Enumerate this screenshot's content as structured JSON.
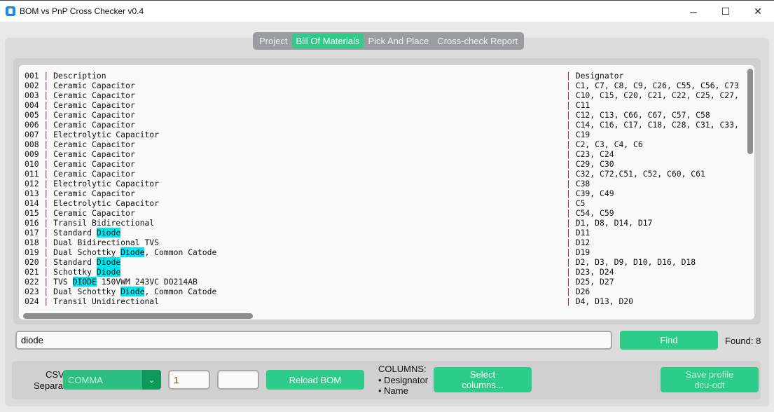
{
  "window": {
    "title": "BOM vs PnP Cross Checker v0.4",
    "minimize": "─",
    "maximize": "☐",
    "close": "✕"
  },
  "tabs": [
    {
      "label": "Project",
      "active": false
    },
    {
      "label": "Bill Of Materials",
      "active": true
    },
    {
      "label": "Pick And Place",
      "active": false
    },
    {
      "label": "Cross-check Report",
      "active": false
    }
  ],
  "highlight": "diode",
  "rows": [
    {
      "n": "001",
      "desc": "Description",
      "des": "Designator"
    },
    {
      "n": "002",
      "desc": "Ceramic Capacitor",
      "des": "C1, C7, C8, C9, C26, C55, C56, C73"
    },
    {
      "n": "003",
      "desc": "Ceramic Capacitor",
      "des": "C10, C15, C20, C21, C22, C25, C27,"
    },
    {
      "n": "004",
      "desc": "Ceramic Capacitor",
      "des": "C11"
    },
    {
      "n": "005",
      "desc": "Ceramic Capacitor",
      "des": "C12, C13, C66, C67, C57, C58"
    },
    {
      "n": "006",
      "desc": "Ceramic Capacitor",
      "des": "C14, C16, C17, C18, C28, C31, C33,"
    },
    {
      "n": "007",
      "desc": "Electrolytic Capacitor",
      "des": "C19"
    },
    {
      "n": "008",
      "desc": "Ceramic Capacitor",
      "des": "C2, C3, C4, C6"
    },
    {
      "n": "009",
      "desc": "Ceramic Capacitor",
      "des": "C23, C24"
    },
    {
      "n": "010",
      "desc": "Ceramic Capacitor",
      "des": "C29, C30"
    },
    {
      "n": "011",
      "desc": "Ceramic Capacitor",
      "des": "C32, C72,C51, C52, C60, C61"
    },
    {
      "n": "012",
      "desc": "Electrolytic Capacitor",
      "des": "C38"
    },
    {
      "n": "013",
      "desc": "Ceramic Capacitor",
      "des": "C39, C49"
    },
    {
      "n": "014",
      "desc": "Electrolytic Capacitor",
      "des": "C5"
    },
    {
      "n": "015",
      "desc": "Ceramic Capacitor",
      "des": "C54, C59"
    },
    {
      "n": "016",
      "desc": "Transil Bidirectional",
      "des": "D1, D8, D14, D17"
    },
    {
      "n": "017",
      "desc": "Standard Diode",
      "des": "D11"
    },
    {
      "n": "018",
      "desc": "Dual Bidirectional TVS",
      "des": "D12"
    },
    {
      "n": "019",
      "desc": "Dual Schottky Diode, Common Catode",
      "des": "D19"
    },
    {
      "n": "020",
      "desc": "Standard Diode",
      "des": "D2, D3, D9, D10, D16, D18"
    },
    {
      "n": "021",
      "desc": "Schottky Diode",
      "des": "D23, D24"
    },
    {
      "n": "022",
      "desc": "TVS DIODE 150VWM 243VC DO214AB",
      "des": "D25, D27"
    },
    {
      "n": "023",
      "desc": "Dual Schottky Diode, Common Catode",
      "des": "D26"
    },
    {
      "n": "024",
      "desc": "Transil Unidirectional",
      "des": "D4, D13, D20"
    }
  ],
  "search": {
    "value": "diode",
    "find_label": "Find",
    "found": "Found: 8"
  },
  "bottom": {
    "csv_label": "CSV\nSeparator:",
    "separator": "COMMA",
    "chevron": "⌄",
    "field1": "1",
    "field2": "",
    "reload": "Reload BOM",
    "columns_title": "COLUMNS:",
    "columns": [
      "• Designator",
      "• Name"
    ],
    "select_columns": "Select\ncolumns...",
    "save_profile": "Save profile\ndcu-odt"
  },
  "colors": {
    "accent": "#2ecc8a",
    "highlight": "#00e5ee"
  }
}
